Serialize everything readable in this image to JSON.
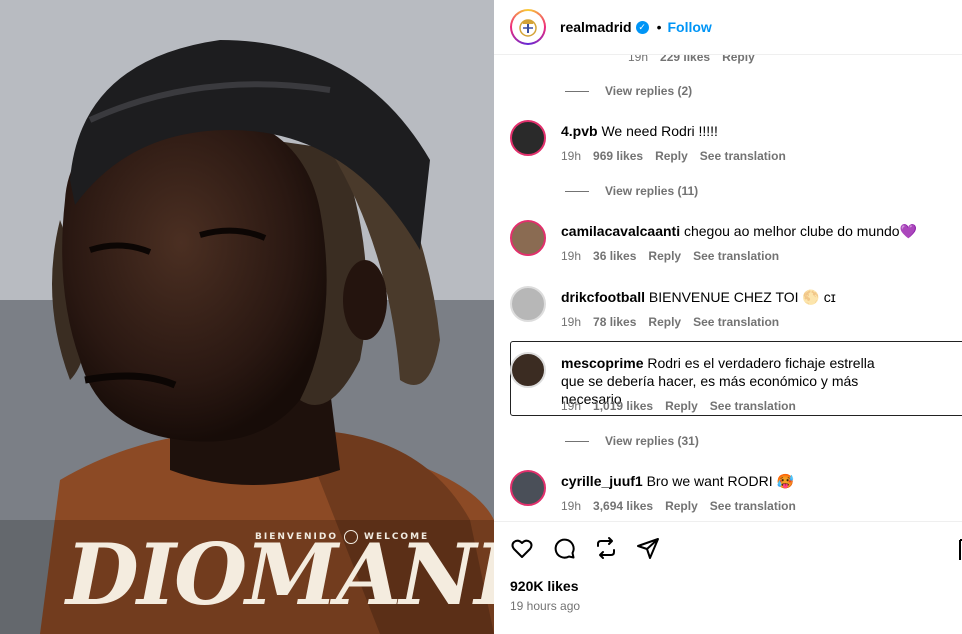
{
  "post_image": {
    "welcome_left": "BIENVENIDO",
    "welcome_right": "WELCOME",
    "player_name": "DIOMANDE"
  },
  "header": {
    "username": "realmadrid",
    "dot": "•",
    "follow_label": "Follow"
  },
  "prev_comment_meta": {
    "time": "19h",
    "likes": "229 likes",
    "reply": "Reply"
  },
  "view_replies": [
    "View replies (2)",
    "View replies (11)",
    "View replies (31)"
  ],
  "comments": [
    {
      "username": "4.pvb",
      "text": "We need Rodri !!!!!",
      "time": "19h",
      "likes": "969 likes",
      "reply": "Reply",
      "translate": "See translation",
      "avatar_color": "#2a2a2a"
    },
    {
      "username": "camilacavalcaanti",
      "text": "chegou ao melhor clube do mundo💜",
      "time": "19h",
      "likes": "36 likes",
      "reply": "Reply",
      "translate": "See translation",
      "avatar_color": "#8a6b52"
    },
    {
      "username": "drikcfootball",
      "text": "BIENVENUE CHEZ TOI 🌕 ᴄɪ",
      "time": "19h",
      "likes": "78 likes",
      "reply": "Reply",
      "translate": "See translation",
      "avatar_color": "#b7b7b7"
    },
    {
      "username": "mescoprime",
      "text": "Rodri es el verdadero fichaje estrella que se debería hacer, es más económico y más necesario",
      "time": "19h",
      "likes": "1,019 likes",
      "reply": "Reply",
      "translate": "See translation",
      "avatar_color": "#3b2c22"
    },
    {
      "username": "cyrille_juuf1",
      "text": "Bro we want RODRI 🥵",
      "time": "19h",
      "likes": "3,694 likes",
      "reply": "Reply",
      "translate": "See translation",
      "avatar_color": "#4a4f58"
    }
  ],
  "footer": {
    "likes": "920K likes",
    "time_ago": "19 hours ago"
  },
  "colors": {
    "accent": "#0095f6",
    "muted": "#737373"
  }
}
